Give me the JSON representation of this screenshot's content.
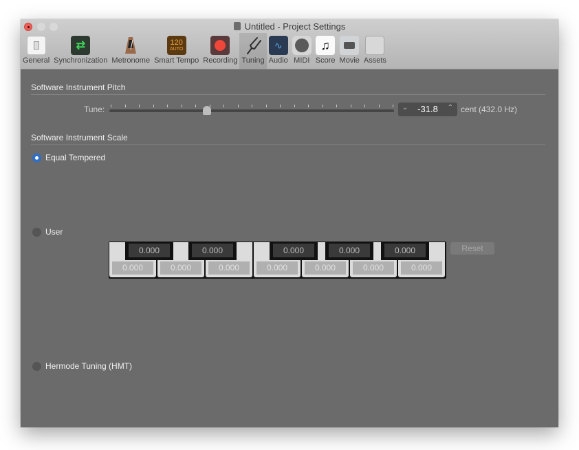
{
  "window": {
    "title": "Untitled - Project Settings"
  },
  "toolbar": {
    "items": [
      {
        "label": "General",
        "icon": "toggle-switch-icon"
      },
      {
        "label": "Synchronization",
        "icon": "sync-arrows-icon",
        "glyph": "⇄"
      },
      {
        "label": "Metronome",
        "icon": "metronome-icon"
      },
      {
        "label": "Smart Tempo",
        "icon": "smart-tempo-icon",
        "line1": "120",
        "line2": "AUTO"
      },
      {
        "label": "Recording",
        "icon": "record-icon"
      },
      {
        "label": "Tuning",
        "icon": "tuning-fork-icon",
        "glyph": "⟋",
        "active": true
      },
      {
        "label": "Audio",
        "icon": "audio-waveform-icon",
        "glyph": "∿"
      },
      {
        "label": "MIDI",
        "icon": "midi-connector-icon"
      },
      {
        "label": "Score",
        "icon": "music-note-icon",
        "glyph": "♫"
      },
      {
        "label": "Movie",
        "icon": "video-camera-icon"
      },
      {
        "label": "Assets",
        "icon": "briefcase-icon"
      }
    ]
  },
  "pitch": {
    "section_title": "Software Instrument Pitch",
    "tune_label": "Tune:",
    "tune_value": "-31.8",
    "tune_cents": -31.8,
    "tune_range": [
      -100,
      100
    ],
    "tick_count": 21,
    "unit_label": "cent  (432.0 Hz)",
    "down_arrow": "⌄",
    "up_arrow": "⌃"
  },
  "scale": {
    "section_title": "Software Instrument Scale",
    "options": [
      {
        "label": "Equal Tempered",
        "selected": true
      },
      {
        "label": "User",
        "selected": false
      },
      {
        "label": "Hermode Tuning (HMT)",
        "selected": false
      }
    ],
    "black_keys": [
      "0.000",
      "0.000",
      "0.000",
      "0.000",
      "0.000"
    ],
    "white_keys": [
      "0.000",
      "0.000",
      "0.000",
      "0.000",
      "0.000",
      "0.000",
      "0.000"
    ],
    "reset_label": "Reset"
  }
}
